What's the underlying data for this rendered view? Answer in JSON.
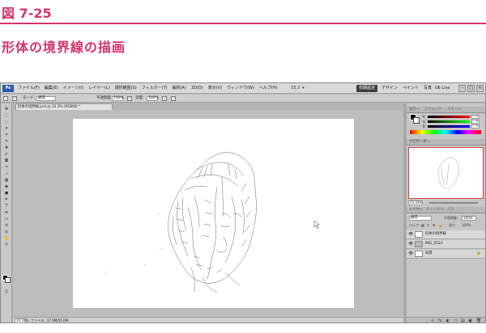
{
  "page": {
    "figure_label": "図 7-25",
    "section_title": "形体の境界線の描画"
  },
  "app": {
    "logo": "Ps",
    "menu": [
      "ファイル(F)",
      "編集(E)",
      "イメージ(I)",
      "レイヤー(L)",
      "選択範囲(S)",
      "フィルター(T)",
      "解析(A)",
      "3D(D)",
      "表示(V)",
      "ウィンドウ(W)",
      "ヘルプ(H)"
    ],
    "menu_tools": [
      "33.3",
      "▾"
    ],
    "workspace_active": "初期設定",
    "workspaces": [
      "デザイン",
      "ペイント",
      "写真",
      "»"
    ],
    "cslive": "CS Live",
    "window_buttons": [
      "–",
      "□",
      "×"
    ]
  },
  "options": {
    "mode_label": "モード：",
    "mode_value": "通常",
    "opacity_label": "不透明度：",
    "opacity_value": "100%",
    "flow_label": "流量：",
    "flow_value": "100%"
  },
  "document": {
    "tab": "形体の境界線.psd @ 33.3% (RGB/8) *",
    "zoom": "33.33%",
    "file_info": "ファイル：17.6M/55.0M"
  },
  "panels": {
    "color_tabs": [
      "カラー",
      "スウォッチ",
      "スタイル"
    ],
    "sliders": [
      {
        "label": "R",
        "value": "0",
        "color": "#d03030"
      },
      {
        "label": "G",
        "value": "0",
        "color": "#30a030"
      },
      {
        "label": "B",
        "value": "0",
        "color": "#3040d0"
      }
    ],
    "navigator_tab": "ナビゲーター",
    "navigator_zoom": "33.33%",
    "layer_tabs": [
      "レイヤー",
      "チャンネル",
      "パス"
    ],
    "blend_mode": "通常",
    "opacity_label": "不透明度：",
    "opacity_value": "100%",
    "lock_label": "ロック：",
    "fill_label": "塗り：",
    "fill_value": "100%",
    "layers": [
      {
        "name": "形体の境界線",
        "lock": ""
      },
      {
        "name": "IMG_0123",
        "lock": ""
      },
      {
        "name": "背景",
        "lock": "🔒"
      }
    ],
    "footer_icons": [
      "∞",
      "fx",
      "◐",
      "▭",
      "▤",
      "▣",
      "🗑"
    ]
  }
}
